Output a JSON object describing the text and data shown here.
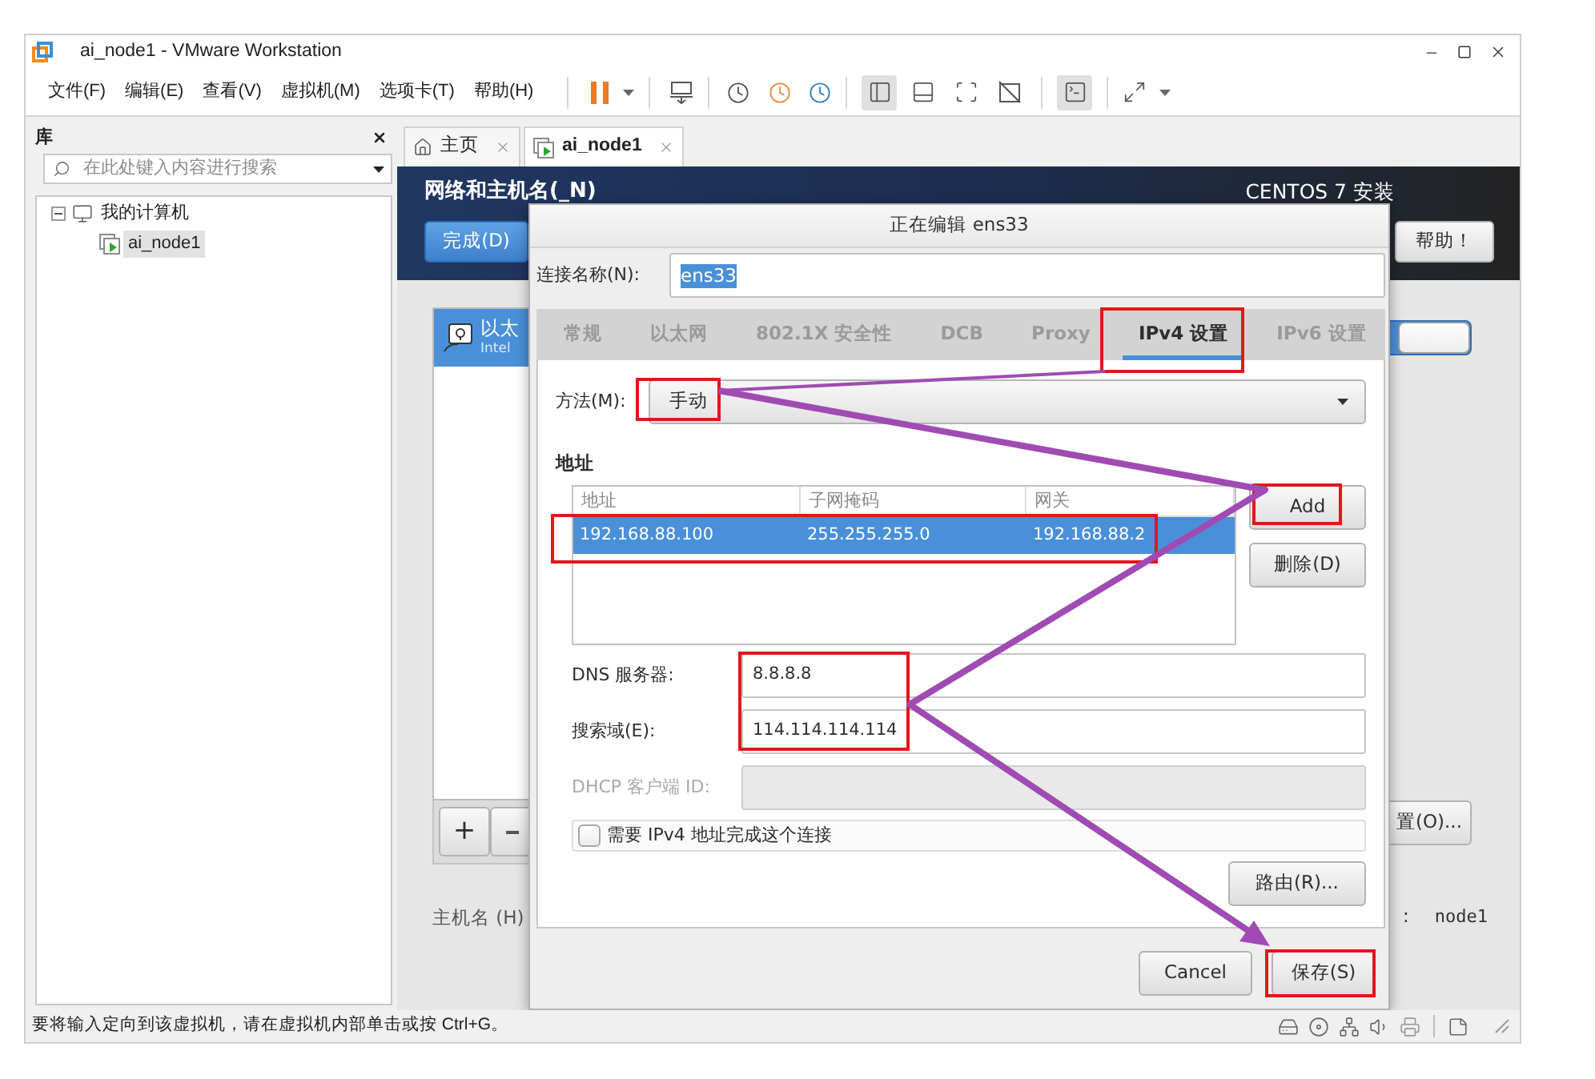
{
  "window": {
    "title": "ai_node1 - VMware Workstation"
  },
  "menu": [
    "文件(F)",
    "编辑(E)",
    "查看(V)",
    "虚拟机(M)",
    "选项卡(T)",
    "帮助(H)"
  ],
  "toolbar": {
    "toggles": [
      {
        "pressed": true
      },
      {
        "pressed": false
      },
      {
        "pressed": false
      },
      {
        "pressed": false
      },
      {
        "pressed": true
      }
    ]
  },
  "library": {
    "title": "库",
    "search": {
      "placeholder": "在此处键入内容进行搜索"
    },
    "tree": [
      {
        "label": "我的计算机",
        "expanded": true,
        "selected": false,
        "children": [
          {
            "label": "ai_node1",
            "selected": true
          }
        ]
      }
    ]
  },
  "tabs": [
    {
      "label": "主页",
      "selected": false
    },
    {
      "label": "ai_node1",
      "selected": true
    }
  ],
  "installer": {
    "title": "网络和主机名(_N)",
    "done_button": "完成(D)",
    "product": "CENTOS 7 安装",
    "help_button": "帮助！",
    "devices": [
      {
        "name": "以太",
        "detail": "Intel",
        "selected": true
      }
    ],
    "add_button": "+",
    "hostname_label": "主机名 (H)",
    "switch": {
      "on": true
    },
    "configure_button": "置(O)...",
    "hostname_separator": ":",
    "hostname": "node1"
  },
  "dialog": {
    "title": "正在编辑 ens33",
    "connection_name": {
      "label": "连接名称(N):",
      "value": "ens33",
      "value_selected": true
    },
    "tabs": [
      {
        "label": "常规",
        "selected": false
      },
      {
        "label": "以太网",
        "selected": false
      },
      {
        "label": "802.1X 安全性",
        "selected": false
      },
      {
        "label": "DCB",
        "selected": false
      },
      {
        "label": "Proxy",
        "selected": false
      },
      {
        "label": "IPv4 设置",
        "selected": true
      },
      {
        "label": "IPv6 设置",
        "selected": false
      }
    ],
    "method": {
      "label": "方法(M):",
      "value": "手动"
    },
    "addresses": {
      "title": "地址",
      "columns": [
        "地址",
        "子网掩码",
        "网关"
      ],
      "rows": [
        {
          "cells": [
            "192.168.88.100",
            "255.255.255.0",
            "192.168.88.2"
          ],
          "selected": true
        }
      ],
      "buttons": [
        "Add",
        "删除(D)"
      ]
    },
    "fields": [
      {
        "label": "DNS 服务器:",
        "value": "8.8.8.8",
        "disabled": false
      },
      {
        "label": "搜索域(E):",
        "value": "114.114.114.114",
        "disabled": false
      },
      {
        "label": "DHCP 客户端 ID:",
        "disabled": true
      }
    ],
    "require_ipv4": {
      "label": "需要 IPv4 地址完成这个连接",
      "checked": false
    },
    "routes_button": "路由(R)...",
    "buttons": [
      "Cancel",
      "保存(S)"
    ]
  },
  "status_bar": {
    "text": "要将输入定向到该虚拟机，请在虚拟机内部单击或按 Ctrl+G。"
  }
}
